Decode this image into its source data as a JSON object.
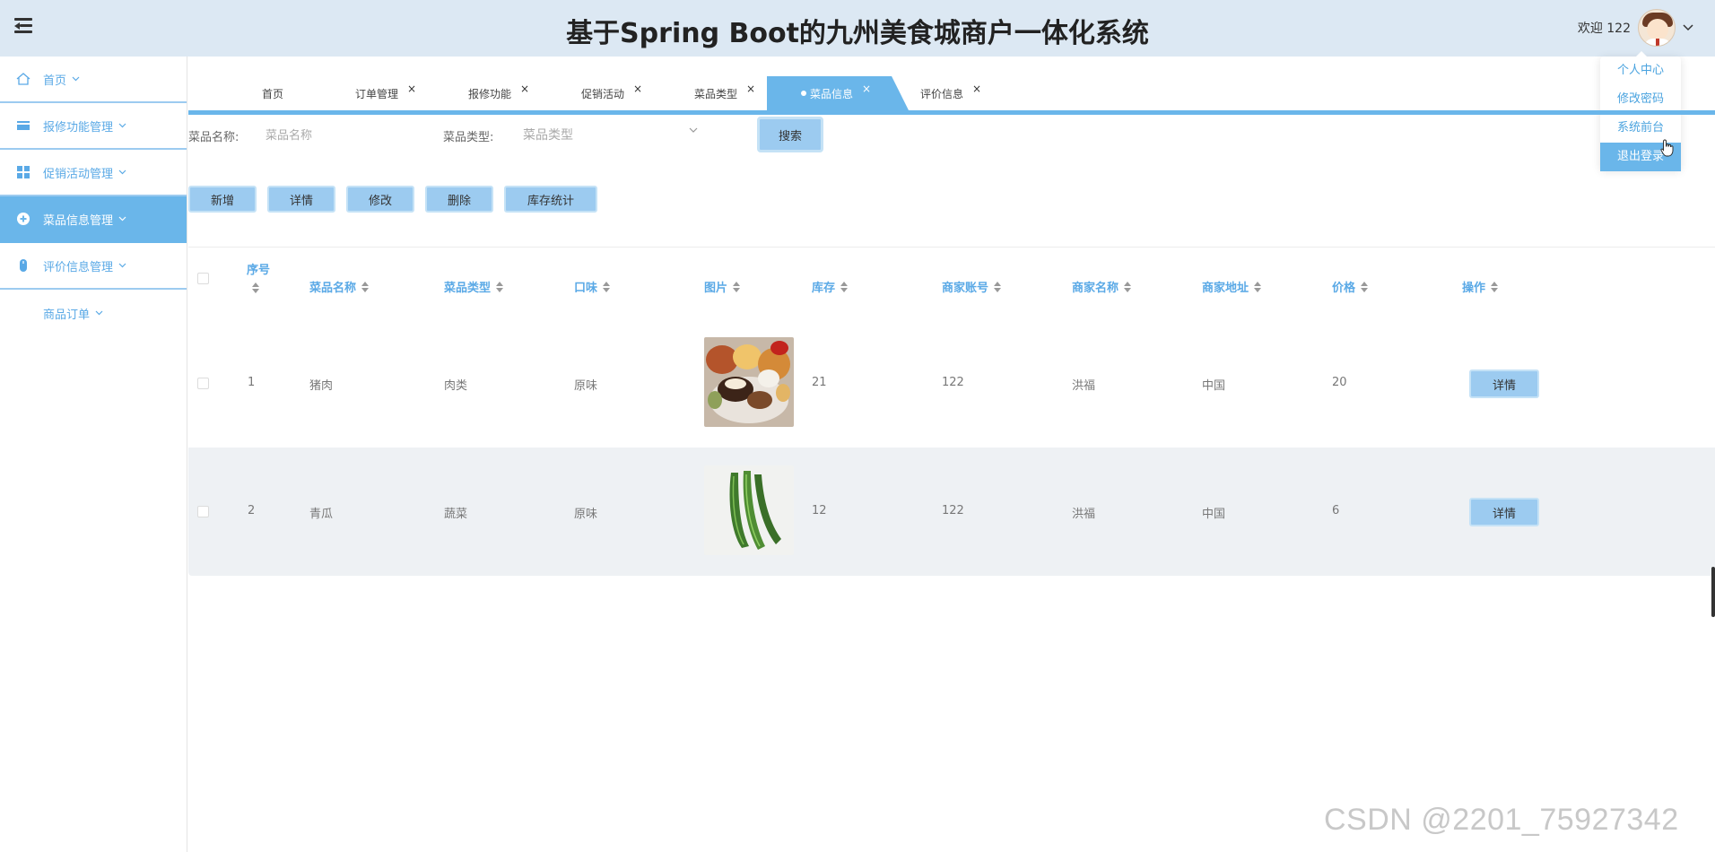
{
  "header": {
    "title": "基于Spring Boot的九州美食城商户一体化系统",
    "welcome": "欢迎 122",
    "avatar_icon": "user-avatar-icon"
  },
  "user_menu": {
    "items": [
      "个人中心",
      "修改密码",
      "系统前台",
      "退出登录"
    ],
    "active_index": 3
  },
  "sidebar": {
    "items": [
      {
        "label": "首页",
        "icon": "home-icon"
      },
      {
        "label": "报修功能管理",
        "icon": "card-icon"
      },
      {
        "label": "促销活动管理",
        "icon": "grid-icon"
      },
      {
        "label": "菜品信息管理",
        "icon": "plus-circle-icon"
      },
      {
        "label": "评价信息管理",
        "icon": "mouse-icon"
      },
      {
        "label": "商品订单",
        "icon": ""
      }
    ],
    "active_index": 3
  },
  "tabs": {
    "items": [
      {
        "label": "首页",
        "closable": false
      },
      {
        "label": "订单管理",
        "closable": true
      },
      {
        "label": "报修功能",
        "closable": true
      },
      {
        "label": "促销活动",
        "closable": true
      },
      {
        "label": "菜品类型",
        "closable": true
      },
      {
        "label": "菜品信息",
        "closable": true
      },
      {
        "label": "评价信息",
        "closable": true
      }
    ],
    "active_index": 5,
    "close_symbol": "×"
  },
  "search": {
    "name_label": "菜品名称:",
    "name_placeholder": "菜品名称",
    "type_label": "菜品类型:",
    "type_placeholder": "菜品类型",
    "button": "搜索"
  },
  "actions": [
    "新增",
    "详情",
    "修改",
    "删除",
    "库存统计"
  ],
  "table": {
    "columns": [
      "序号",
      "菜品名称",
      "菜品类型",
      "口味",
      "图片",
      "库存",
      "商家账号",
      "商家名称",
      "商家地址",
      "价格",
      "操作"
    ],
    "rows": [
      {
        "index": "1",
        "name": "猪肉",
        "type": "肉类",
        "flavor": "原味",
        "image": "cake-dessert-image",
        "stock": "21",
        "account": "122",
        "merchant": "洪福",
        "address": "中国",
        "price": "20",
        "op": "详情"
      },
      {
        "index": "2",
        "name": "青瓜",
        "type": "蔬菜",
        "flavor": "原味",
        "image": "cucumber-image",
        "stock": "12",
        "account": "122",
        "merchant": "洪福",
        "address": "中国",
        "price": "6",
        "op": "详情"
      }
    ]
  },
  "watermark": "CSDN @2201_75927342",
  "colors": {
    "header_bg": "#dce8f3",
    "accent": "#6ab6ea",
    "button": "#9ccbf0",
    "link": "#5aa9e6"
  }
}
